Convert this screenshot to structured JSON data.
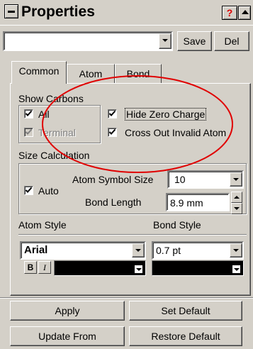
{
  "window": {
    "title": "Properties",
    "help_label": "?"
  },
  "style_bar": {
    "style_value": "",
    "save_label": "Save",
    "del_label": "Del"
  },
  "tabs": [
    {
      "label": "Common",
      "active": true
    },
    {
      "label": "Atom",
      "active": false
    },
    {
      "label": "Bond",
      "active": false
    }
  ],
  "show_carbons": {
    "heading": "Show Carbons",
    "all_label": "All",
    "all_checked": true,
    "terminal_label": "Terminal",
    "terminal_checked": true,
    "terminal_enabled": false,
    "hide_zero_charge_label": "Hide Zero Charge",
    "hide_zero_charge_checked": true,
    "cross_out_invalid_label": "Cross Out Invalid Atom",
    "cross_out_invalid_checked": true
  },
  "size_calc": {
    "heading": "Size Calculation",
    "auto_label": "Auto",
    "auto_checked": true,
    "atom_symbol_size_label": "Atom Symbol Size",
    "atom_symbol_size_value": "10",
    "bond_length_label": "Bond Length",
    "bond_length_value": "8.9 mm"
  },
  "atom_style": {
    "heading": "Atom Style",
    "font_value": "Arial",
    "bold_label": "B",
    "italic_label": "I"
  },
  "bond_style": {
    "heading": "Bond Style",
    "width_value": "0.7 pt"
  },
  "actions": {
    "apply_label": "Apply",
    "set_default_label": "Set Default",
    "update_from_label": "Update From",
    "restore_default_label": "Restore Default"
  },
  "annotation": {
    "shape": "ellipse",
    "color": "#e00000"
  },
  "colors": {
    "face": "#d4d0c8",
    "text": "#000000",
    "disabled": "#808080",
    "help": "#dd0000"
  }
}
